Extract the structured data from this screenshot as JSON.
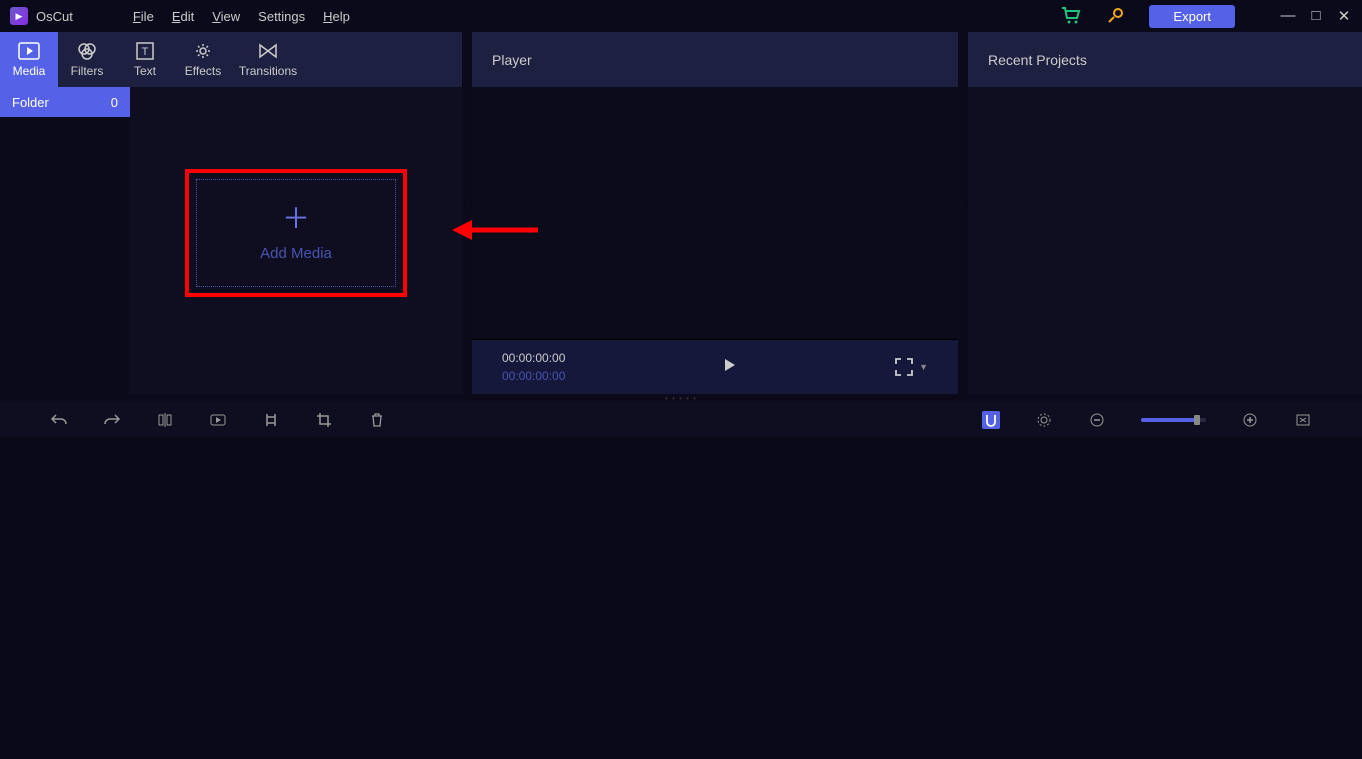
{
  "app": {
    "title": "OsCut"
  },
  "menu": {
    "file": "File",
    "edit": "Edit",
    "view": "View",
    "settings": "Settings",
    "help": "Help"
  },
  "header": {
    "export": "Export"
  },
  "tabs": {
    "media": "Media",
    "filters": "Filters",
    "text": "Text",
    "effects": "Effects",
    "transitions": "Transitions"
  },
  "panels": {
    "player": "Player",
    "recent": "Recent Projects"
  },
  "sidebar": {
    "folder_label": "Folder",
    "folder_count": "0"
  },
  "media": {
    "add_label": "Add Media"
  },
  "player": {
    "timecode_current": "00:00:00:00",
    "timecode_total": "00:00:00:00"
  },
  "icons": {
    "cart": "cart",
    "upgrade": "upgrade",
    "minimize": "—",
    "maximize": "□",
    "close": "✕"
  }
}
